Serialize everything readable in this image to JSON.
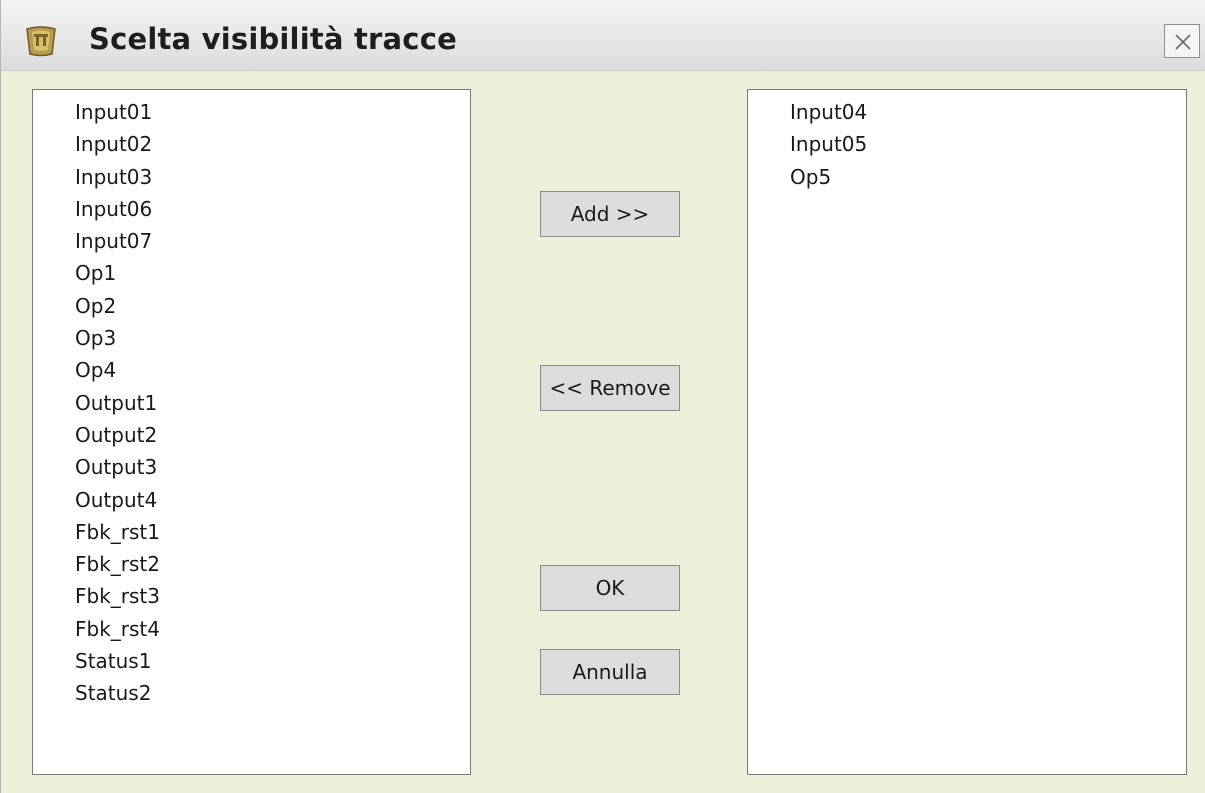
{
  "window": {
    "title": "Scelta visibilità tracce",
    "icon": "trace-app-icon",
    "close_icon": "close-icon"
  },
  "available_list": {
    "items": [
      "Input01",
      "Input02",
      "Input03",
      "Input06",
      "Input07",
      "Op1",
      "Op2",
      "Op3",
      "Op4",
      "Output1",
      "Output2",
      "Output3",
      "Output4",
      "Fbk_rst1",
      "Fbk_rst2",
      "Fbk_rst3",
      "Fbk_rst4",
      "Status1",
      "Status2"
    ]
  },
  "selected_list": {
    "items": [
      "Input04",
      "Input05",
      "Op5"
    ]
  },
  "buttons": {
    "add_label": "Add >>",
    "remove_label": "<< Remove",
    "ok_label": "OK",
    "cancel_label": "Annulla"
  },
  "colors": {
    "dialog_background": "#eeefd9",
    "titlebar": "#e6e6e6",
    "button_face": "#dcdcdc",
    "list_background": "#ffffff"
  }
}
